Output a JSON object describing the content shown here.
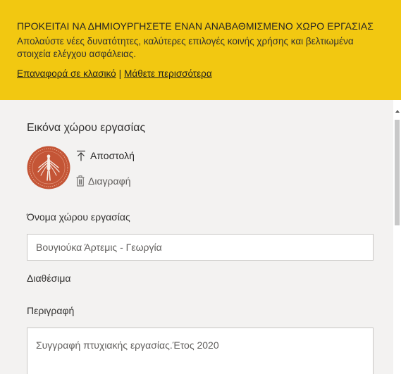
{
  "banner": {
    "title": "ΠΡΟΚΕΙΤΑΙ ΝΑ ΔΗΜΙΟΥΡΓΗΣΕΤΕ ΕΝΑΝ ΑΝΑΒΑΘΜΙΣΜΕΝΟ ΧΩΡΟ ΕΡΓΑΣΙΑΣ",
    "description": "Απολαύστε νέες δυνατότητες, καλύτερες επιλογές κοινής χρήσης και βελτιωμένα στοιχεία ελέγχου ασφάλειας.",
    "revert_link": "Επαναφορά σε κλασικό",
    "separator": "|",
    "learn_more_link": "Μάθετε περισσότερα",
    "background_color": "#f2c811"
  },
  "workspace_image": {
    "section_title": "Εικόνα χώρου εργασίας",
    "upload_label": "Αποστολή",
    "delete_label": "Διαγραφή",
    "upload_icon": "upload-icon",
    "delete_icon": "trash-icon"
  },
  "workspace_name": {
    "label": "Όνομα χώρου εργασίας",
    "value": "Βουγιούκα Άρτεμις - Γεωργία"
  },
  "available": {
    "label": "Διαθέσιμα"
  },
  "description": {
    "label": "Περιγραφή",
    "value": "Συγγραφή πτυχιακής εργασίας.Έτος 2020"
  }
}
